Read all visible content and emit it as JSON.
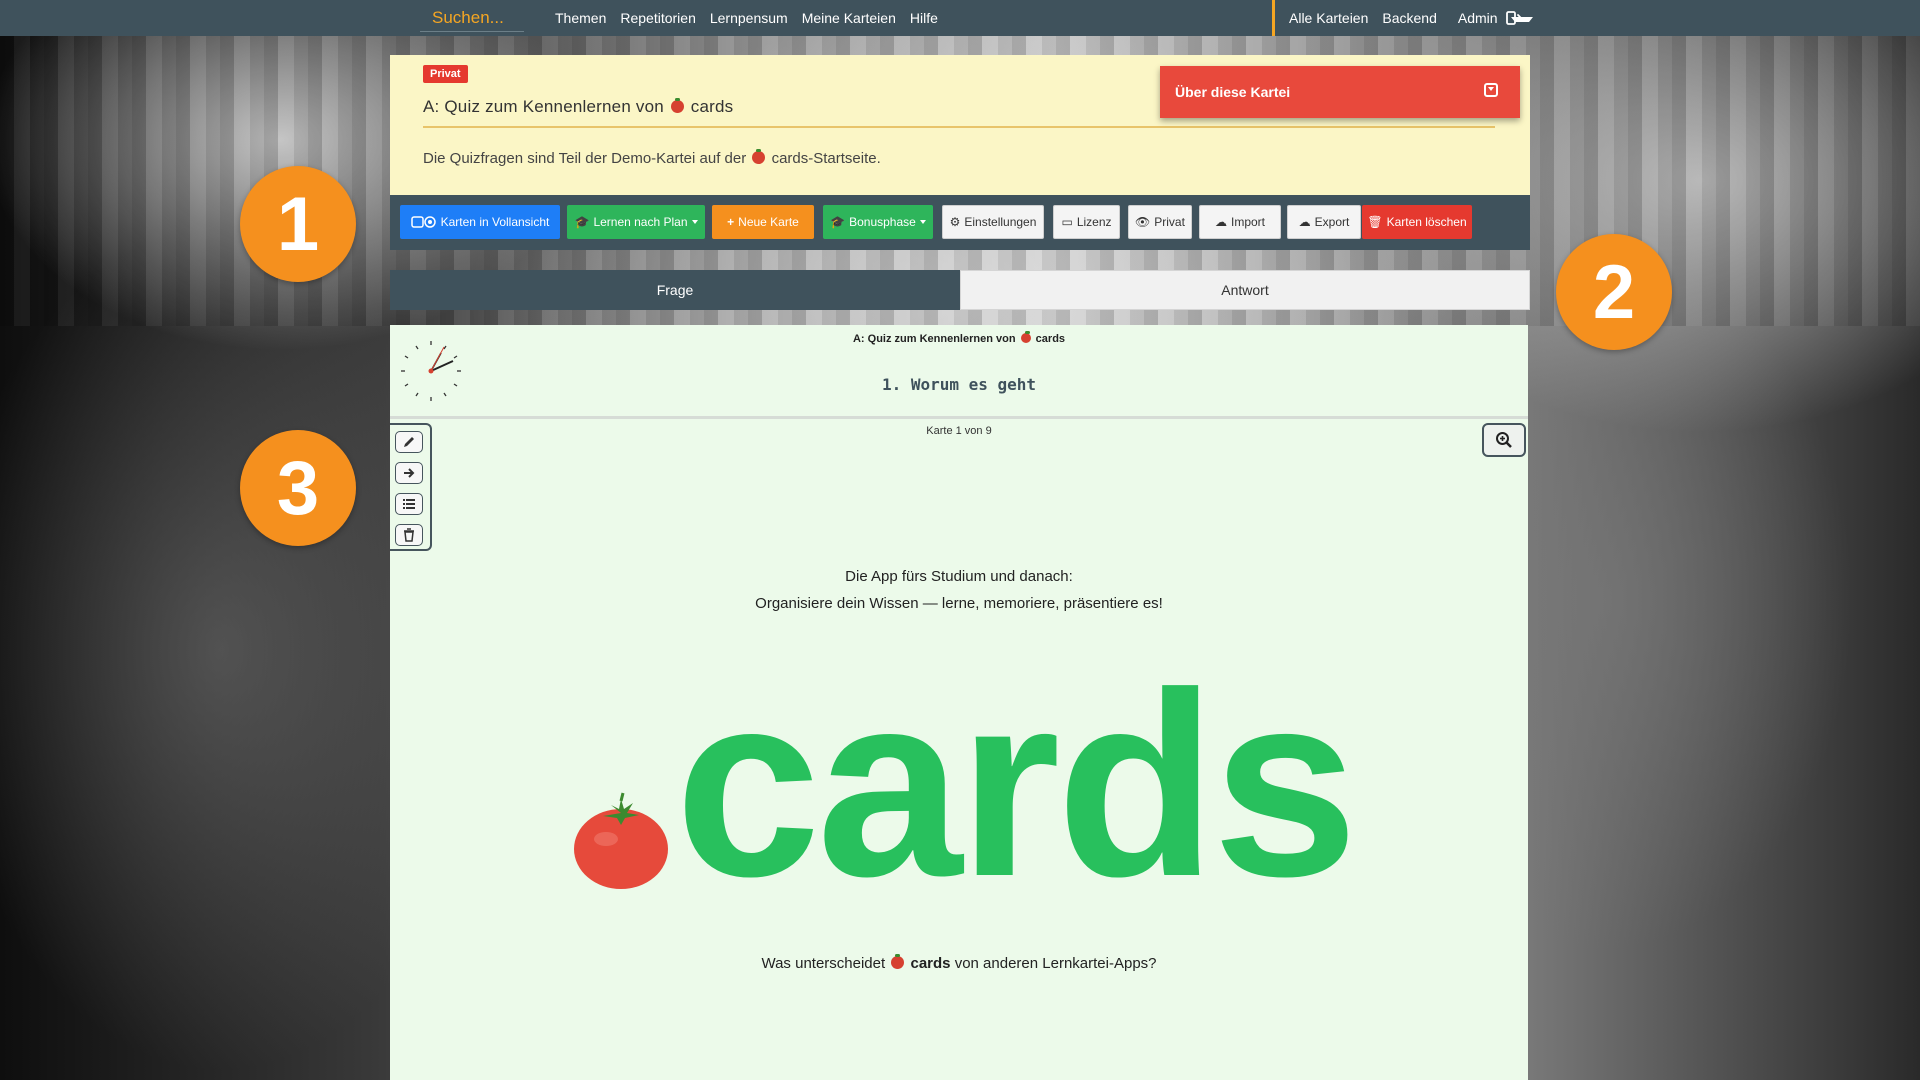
{
  "navbar": {
    "search_placeholder": "Suchen...",
    "links": [
      "Themen",
      "Repetitorien",
      "Lernpensum",
      "Meine Karteien",
      "Hilfe"
    ],
    "right_links": [
      "Alle Karteien",
      "Backend"
    ],
    "admin_label": "Admin",
    "accent_color": "#f5a623"
  },
  "header": {
    "badge": "Privat",
    "title_prefix": "A: Quiz zum Kennenlernen von",
    "title_suffix": "cards",
    "description_prefix": "Die Quizfragen sind Teil der Demo-Kartei auf der",
    "description_suffix": "cards-Startseite.",
    "about_button": "Über diese Kartei"
  },
  "toolbar": {
    "fullview": "Karten in Vollansicht",
    "learn_plan": "Lernen nach Plan",
    "new_card": "Neue Karte",
    "bonus": "Bonusphase",
    "settings": "Einstellungen",
    "license": "Lizenz",
    "private": "Privat",
    "import": "Import",
    "export": "Export",
    "delete": "Karten löschen"
  },
  "tabs": {
    "question": "Frage",
    "answer": "Antwort"
  },
  "card": {
    "header_title_prefix": "A: Quiz zum Kennenlernen von",
    "header_title_suffix": "cards",
    "heading": "1. Worum es geht",
    "counter": "Karte 1 von 9",
    "intro_line1": "Die App fürs Studium und danach:",
    "intro_line2": "Organisiere dein Wissen — lerne, memoriere, präsentiere es!",
    "logo_text": "cards",
    "question_prefix": "Was unterscheidet",
    "question_bold": "cards",
    "question_suffix": "von anderen Lernkartei-Apps?"
  },
  "markers": [
    "1",
    "2",
    "3"
  ],
  "colors": {
    "navbar": "#3f525c",
    "header_bg": "#fbf6c6",
    "card_bg": "#ecfaea",
    "brand_green": "#28c05d",
    "marker_orange": "#f5901e",
    "red": "#e5392f"
  }
}
